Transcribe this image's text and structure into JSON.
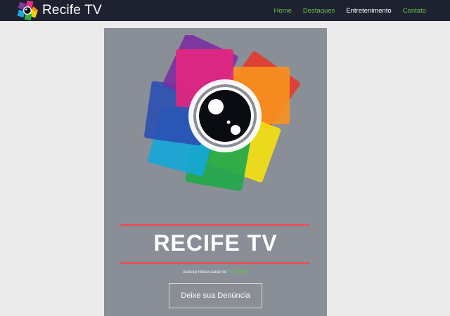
{
  "header": {
    "brand_name": "Recife TV",
    "brand_logo_icon": "camera-petal-logo-icon",
    "nav": {
      "home": "Home",
      "destaques": "Destaques",
      "entretenimento": "Entretenimento",
      "contato": "Contato"
    },
    "active_item": "Entretenimento"
  },
  "banner": {
    "logo_icon": "camera-lens-petals-icon",
    "title": "RECIFE TV",
    "channel_text": "Acesse nosso canal no",
    "channel_link": "Youtube",
    "button_label": "Deixe sua Denúncia"
  },
  "colors": {
    "navbar_bg": "#1e2230",
    "nav_link": "#6cc04a",
    "card_bg": "#8a8e97",
    "accent_line": "#e0555a",
    "page_bg": "#ebebeb"
  }
}
